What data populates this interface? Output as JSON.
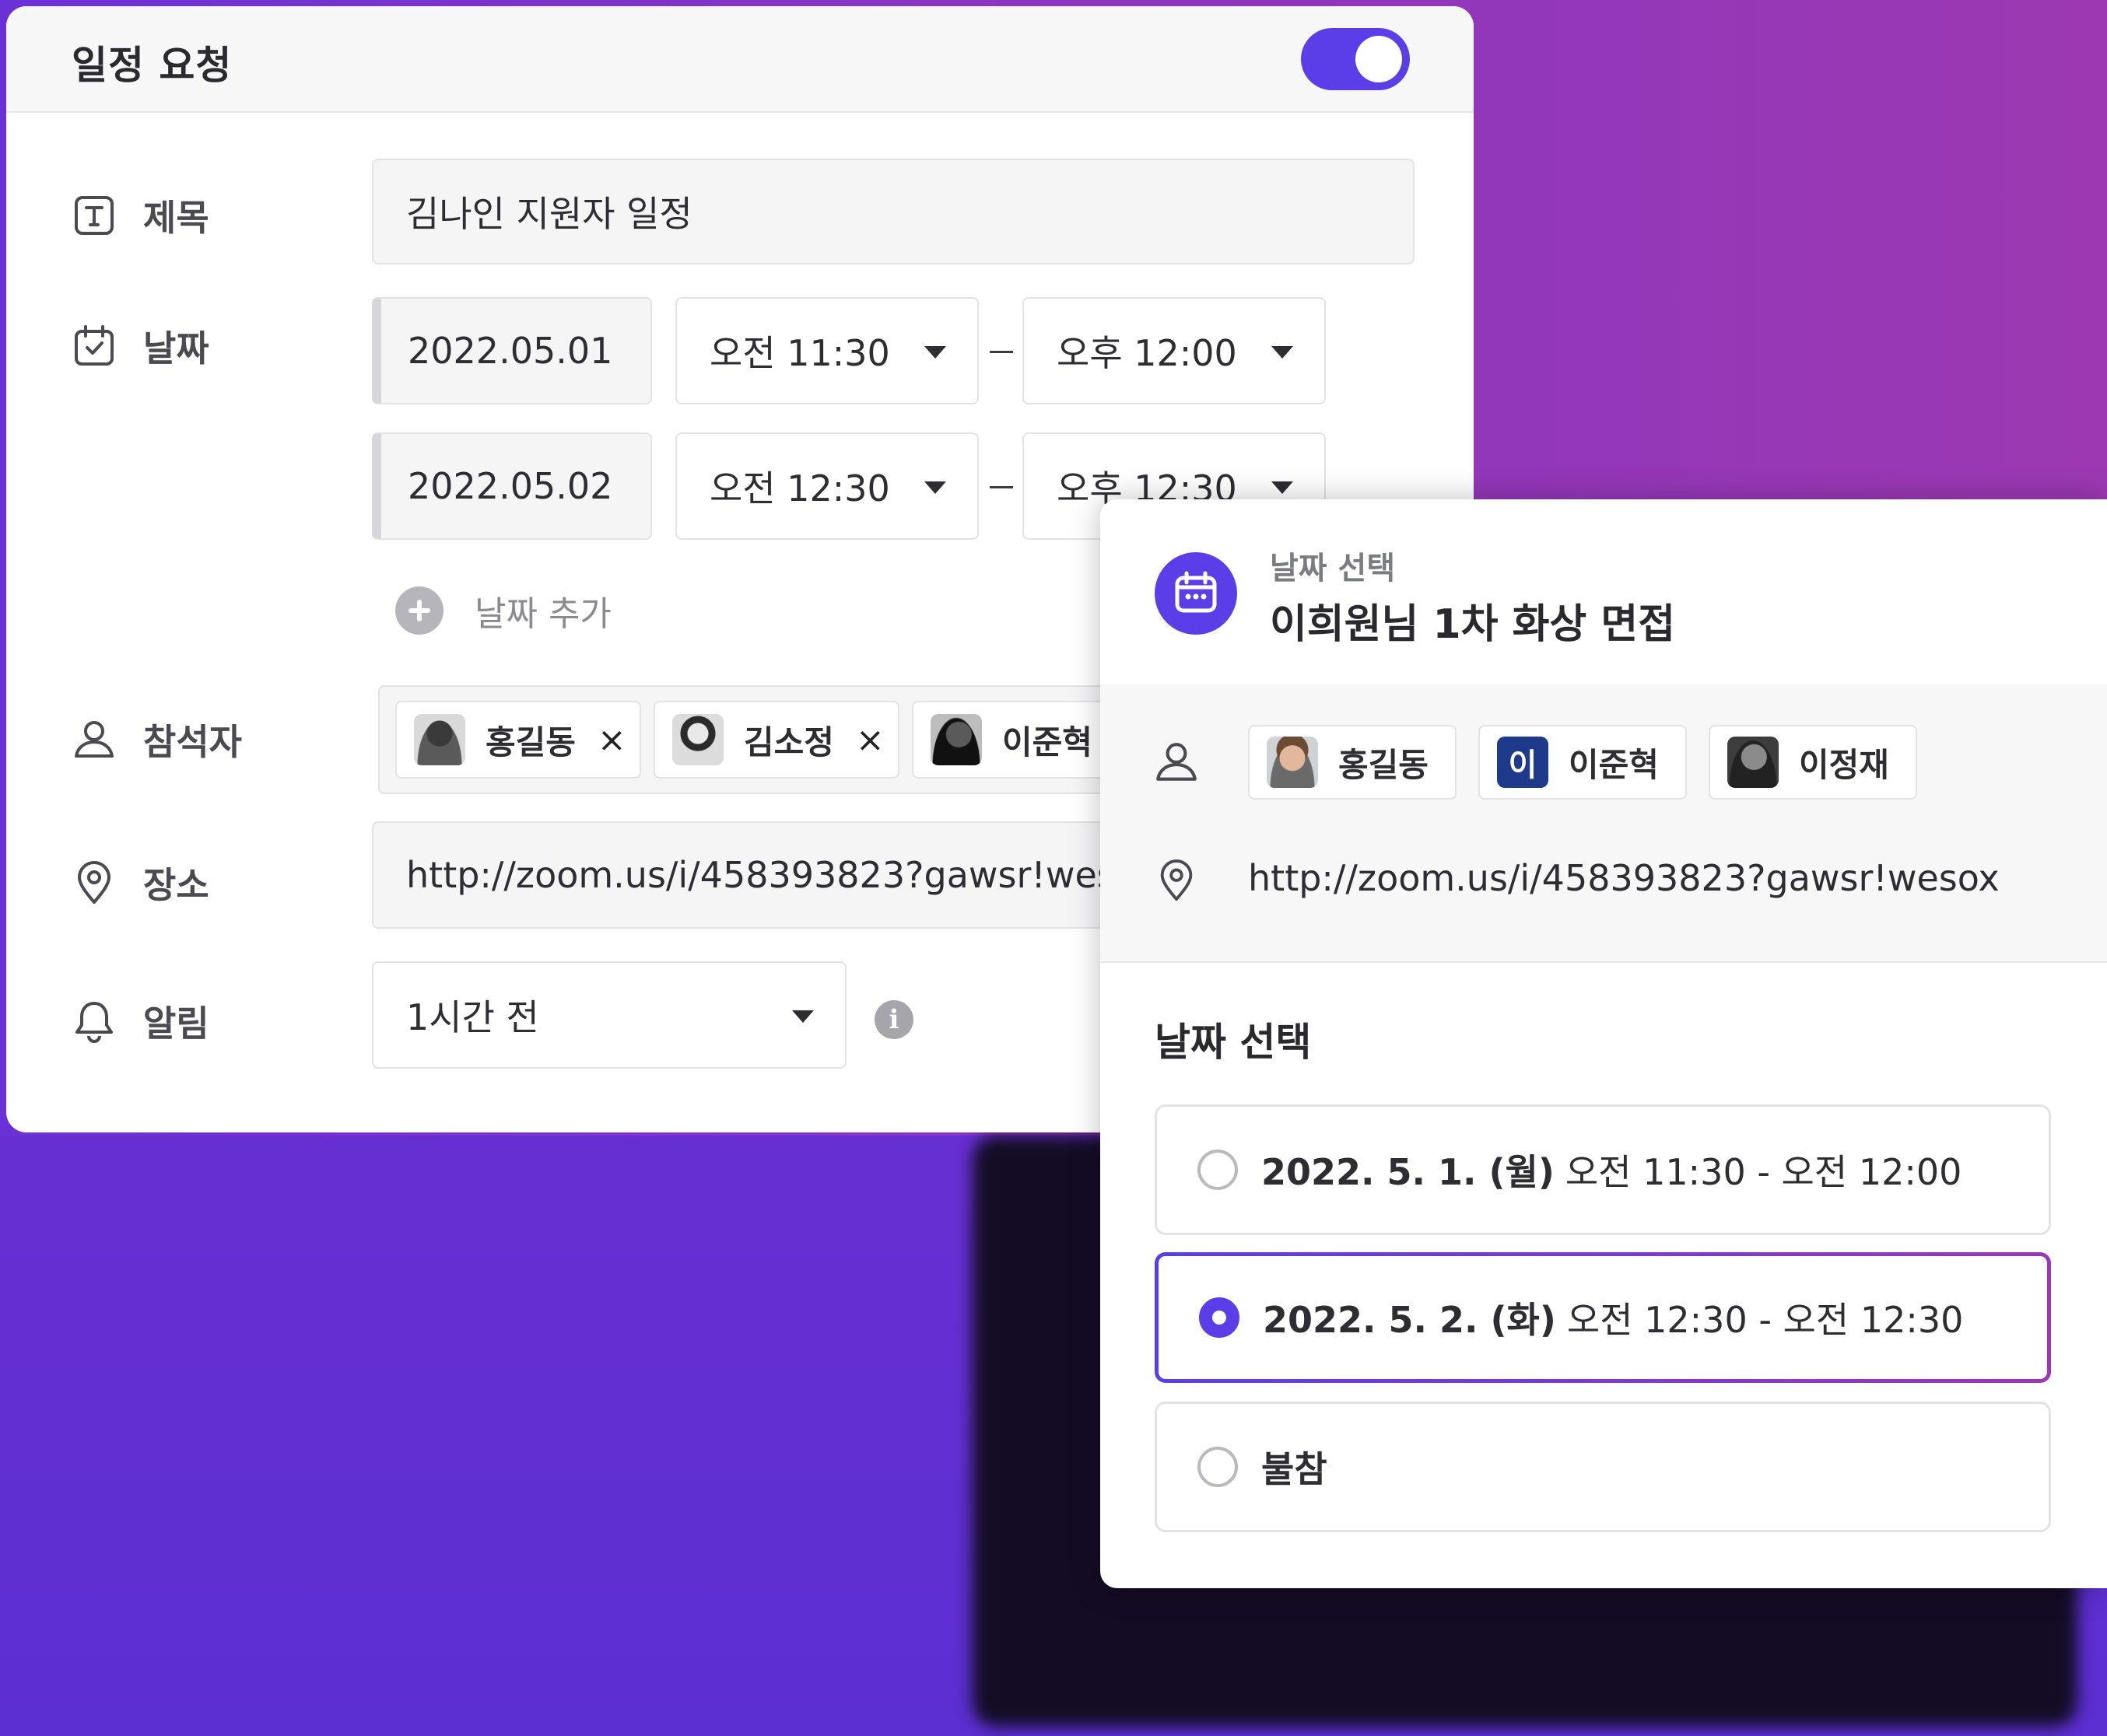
{
  "request_panel": {
    "title": "일정 요청",
    "toggle_on": true,
    "labels": {
      "title": "제목",
      "date": "날짜",
      "attendees": "참석자",
      "location": "장소",
      "alert": "알림"
    },
    "title_value": "김나인 지원자 일정",
    "date_rows": [
      {
        "date": "2022.05.01",
        "start": "오전 11:30",
        "end": "오후 12:00"
      },
      {
        "date": "2022.05.02",
        "start": "오전 12:30",
        "end": "오후 12:30"
      }
    ],
    "add_date_label": "날짜 추가",
    "attendees": [
      {
        "name": "홍길동",
        "remove": "×"
      },
      {
        "name": "김소정",
        "remove": "×"
      },
      {
        "name": "이준혁 I"
      }
    ],
    "location_value": "http://zoom.us/i/458393823?gawsr!wes",
    "alert_value": "1시간 전",
    "accent_color": "#5b3ee8"
  },
  "date_pick_panel": {
    "subtitle": "날짜 선택",
    "title": "이희원님 1차 화상 면접",
    "attendees": [
      {
        "name": "홍길동"
      },
      {
        "name": "이준혁",
        "initial": "이"
      },
      {
        "name": "이정재"
      }
    ],
    "location": "http://zoom.us/i/458393823?gawsr!wesox",
    "section_title": "날짜 선택",
    "options": [
      {
        "date": "2022. 5. 1. (월)",
        "time": "오전 11:30 - 오전 12:00",
        "selected": false
      },
      {
        "date": "2022. 5. 2. (화)",
        "time": "오전 12:30 - 오전 12:30",
        "selected": true
      },
      {
        "date": "불참",
        "time": "",
        "selected": false
      }
    ]
  }
}
